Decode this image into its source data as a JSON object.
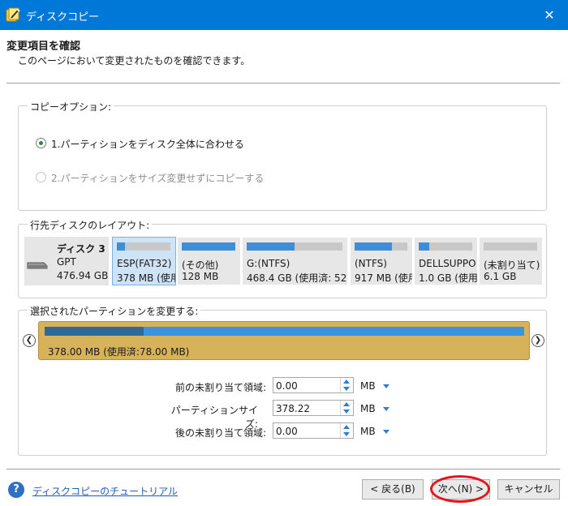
{
  "window": {
    "title": "ディスクコピー",
    "close_glyph": "✕"
  },
  "header": {
    "title": "変更項目を確認",
    "subtitle": "このページにおいて変更されたものを確認できます。"
  },
  "copy_options": {
    "legend": "コピーオプション:",
    "options": [
      {
        "label": "1.パーティションをディスク全体に合わせる",
        "selected": true,
        "enabled": true
      },
      {
        "label": "2.パーティションをサイズ変更せずにコピーする",
        "selected": false,
        "enabled": false
      }
    ]
  },
  "layout": {
    "legend": "行先ディスクのレイアウト:",
    "disk": {
      "name": "ディスク 3",
      "type": "GPT",
      "size": "476.94 GB",
      "icon": "disk-icon"
    },
    "partitions": [
      {
        "name": "ESP(FAT32)",
        "size": "378 MB (使用",
        "used": 0.15,
        "selected": true
      },
      {
        "name": "(その他)",
        "size": "128 MB",
        "used": 1.0,
        "selected": false
      },
      {
        "name": "G:(NTFS)",
        "size": "468.4 GB (使用済: 52",
        "used": 0.5,
        "selected": false
      },
      {
        "name": "(NTFS)",
        "size": "917 MB (使用",
        "used": 0.7,
        "selected": false
      },
      {
        "name": "DELLSUPPO",
        "size": "1.0 GB (使用",
        "used": 0.2,
        "selected": false
      },
      {
        "name": "(未割り当て)",
        "size": "6.1 GB",
        "used": 0.0,
        "selected": false
      }
    ]
  },
  "resize": {
    "legend": "選択されたパーティションを変更する:",
    "summary": "378.00 MB (使用済:78.00 MB)",
    "used_fraction": 0.206,
    "fields": [
      {
        "label": "前の未割り当て領域:",
        "value": "0.00",
        "unit": "MB"
      },
      {
        "label": "パーティションサイズ:",
        "value": "378.22",
        "unit": "MB"
      },
      {
        "label": "後の未割り当て領域:",
        "value": "0.00",
        "unit": "MB"
      }
    ]
  },
  "footer": {
    "help_glyph": "?",
    "tutorial_link": "ディスクコピーのチュートリアル",
    "back_label": "< 戻る(B)",
    "next_label": "次へ(N) >",
    "cancel_label": "キャンセル"
  },
  "colors": {
    "titlebar": "#0078d7",
    "accent_bar": "#3c8fd6",
    "resize_bg": "#d6b25a",
    "highlight": "#e3141b"
  }
}
